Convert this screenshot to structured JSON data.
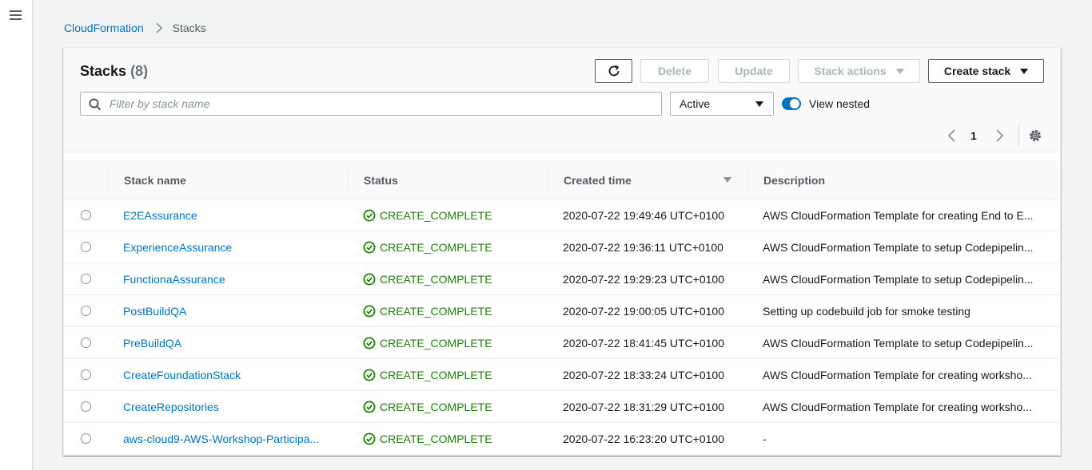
{
  "breadcrumb": {
    "root": "CloudFormation",
    "current": "Stacks"
  },
  "panel": {
    "title": "Stacks",
    "count": "(8)"
  },
  "toolbar": {
    "delete_label": "Delete",
    "update_label": "Update",
    "stack_actions_label": "Stack actions",
    "create_stack_label": "Create stack"
  },
  "filter": {
    "placeholder": "Filter by stack name",
    "status_value": "Active",
    "view_nested_label": "View nested",
    "view_nested_enabled": true
  },
  "pagination": {
    "current_page": "1"
  },
  "table": {
    "columns": {
      "name": "Stack name",
      "status": "Status",
      "created": "Created time",
      "description": "Description"
    },
    "rows": [
      {
        "name": "E2EAssurance",
        "status": "CREATE_COMPLETE",
        "created": "2020-07-22 19:49:46 UTC+0100",
        "description": "AWS CloudFormation Template for creating End to E..."
      },
      {
        "name": "ExperienceAssurance",
        "status": "CREATE_COMPLETE",
        "created": "2020-07-22 19:36:11 UTC+0100",
        "description": "AWS CloudFormation Template to setup Codepipelin..."
      },
      {
        "name": "FunctionaAssurance",
        "status": "CREATE_COMPLETE",
        "created": "2020-07-22 19:29:23 UTC+0100",
        "description": "AWS CloudFormation Template to setup Codepipelin..."
      },
      {
        "name": "PostBuildQA",
        "status": "CREATE_COMPLETE",
        "created": "2020-07-22 19:00:05 UTC+0100",
        "description": "Setting up codebuild job for smoke testing"
      },
      {
        "name": "PreBuildQA",
        "status": "CREATE_COMPLETE",
        "created": "2020-07-22 18:41:45 UTC+0100",
        "description": "AWS CloudFormation Template to setup Codepipelin..."
      },
      {
        "name": "CreateFoundationStack",
        "status": "CREATE_COMPLETE",
        "created": "2020-07-22 18:33:24 UTC+0100",
        "description": "AWS CloudFormation Template for creating worksho..."
      },
      {
        "name": "CreateRepositories",
        "status": "CREATE_COMPLETE",
        "created": "2020-07-22 18:31:29 UTC+0100",
        "description": "AWS CloudFormation Template for creating worksho..."
      },
      {
        "name": "aws-cloud9-AWS-Workshop-Participa...",
        "status": "CREATE_COMPLETE",
        "created": "2020-07-22 16:23:20 UTC+0100",
        "description": "-"
      }
    ]
  },
  "colors": {
    "link": "#0073bb",
    "success": "#1d8102",
    "background": "#f2f3f3"
  },
  "icons": [
    "menu-icon",
    "chevron-right-icon",
    "refresh-icon",
    "search-icon",
    "chevron-left-icon",
    "settings-icon",
    "check-circle-icon",
    "sort-down-icon"
  ]
}
